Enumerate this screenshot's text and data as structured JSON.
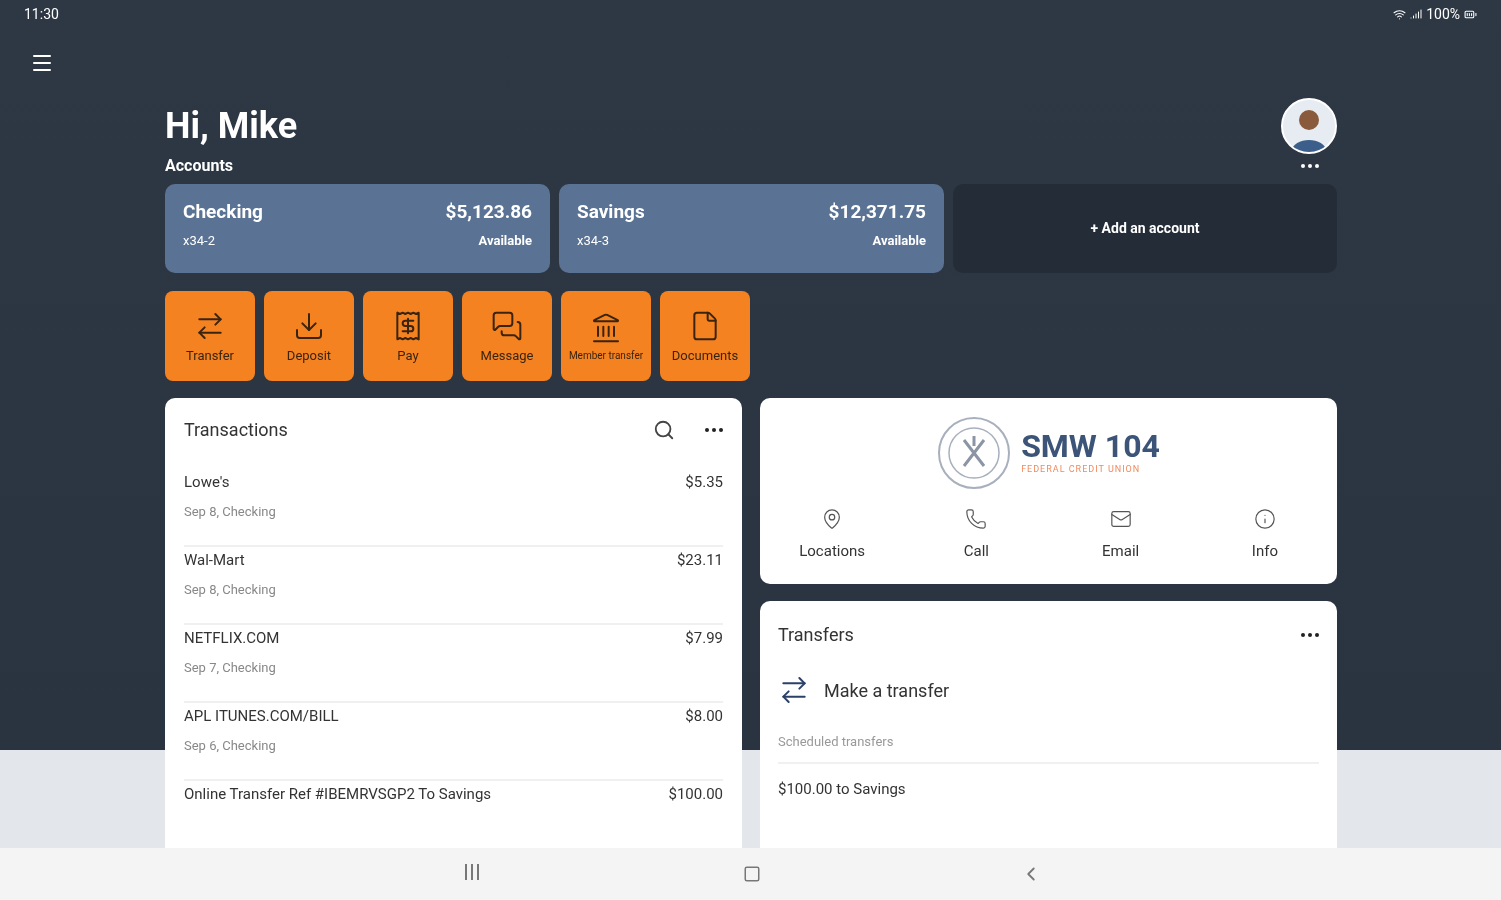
{
  "status_bar": {
    "time": "11:30",
    "battery": "100%"
  },
  "greeting": "Hi, Mike",
  "accounts_title": "Accounts",
  "accounts": [
    {
      "name": "Checking",
      "number": "x34-2",
      "balance": "$5,123.86",
      "balance_label": "Available"
    },
    {
      "name": "Savings",
      "number": "x34-3",
      "balance": "$12,371.75",
      "balance_label": "Available"
    }
  ],
  "add_account": "+ Add an account",
  "actions": [
    {
      "label": "Transfer"
    },
    {
      "label": "Deposit"
    },
    {
      "label": "Pay"
    },
    {
      "label": "Message"
    },
    {
      "label": "Member transfer",
      "small": true
    },
    {
      "label": "Documents"
    }
  ],
  "transactions": {
    "title": "Transactions",
    "items": [
      {
        "merchant": "Lowe's",
        "amount": "$5.35",
        "detail": "Sep 8, Checking"
      },
      {
        "merchant": "Wal-Mart",
        "amount": "$23.11",
        "detail": "Sep 8, Checking"
      },
      {
        "merchant": "NETFLIX.COM",
        "amount": "$7.99",
        "detail": "Sep 7, Checking"
      },
      {
        "merchant": "APL ITUNES.COM/BILL",
        "amount": "$8.00",
        "detail": "Sep 6, Checking"
      },
      {
        "merchant": "Online Transfer Ref #IBEMRVSGP2 To Savings",
        "amount": "$100.00"
      }
    ]
  },
  "credit_union": {
    "name": "SMW 104",
    "subtitle": "FEDERAL CREDIT UNION",
    "links": [
      {
        "label": "Locations"
      },
      {
        "label": "Call"
      },
      {
        "label": "Email"
      },
      {
        "label": "Info"
      }
    ]
  },
  "transfers": {
    "title": "Transfers",
    "make_transfer": "Make a transfer",
    "scheduled_label": "Scheduled transfers",
    "scheduled": [
      {
        "description": "$100.00 to Savings"
      }
    ]
  }
}
